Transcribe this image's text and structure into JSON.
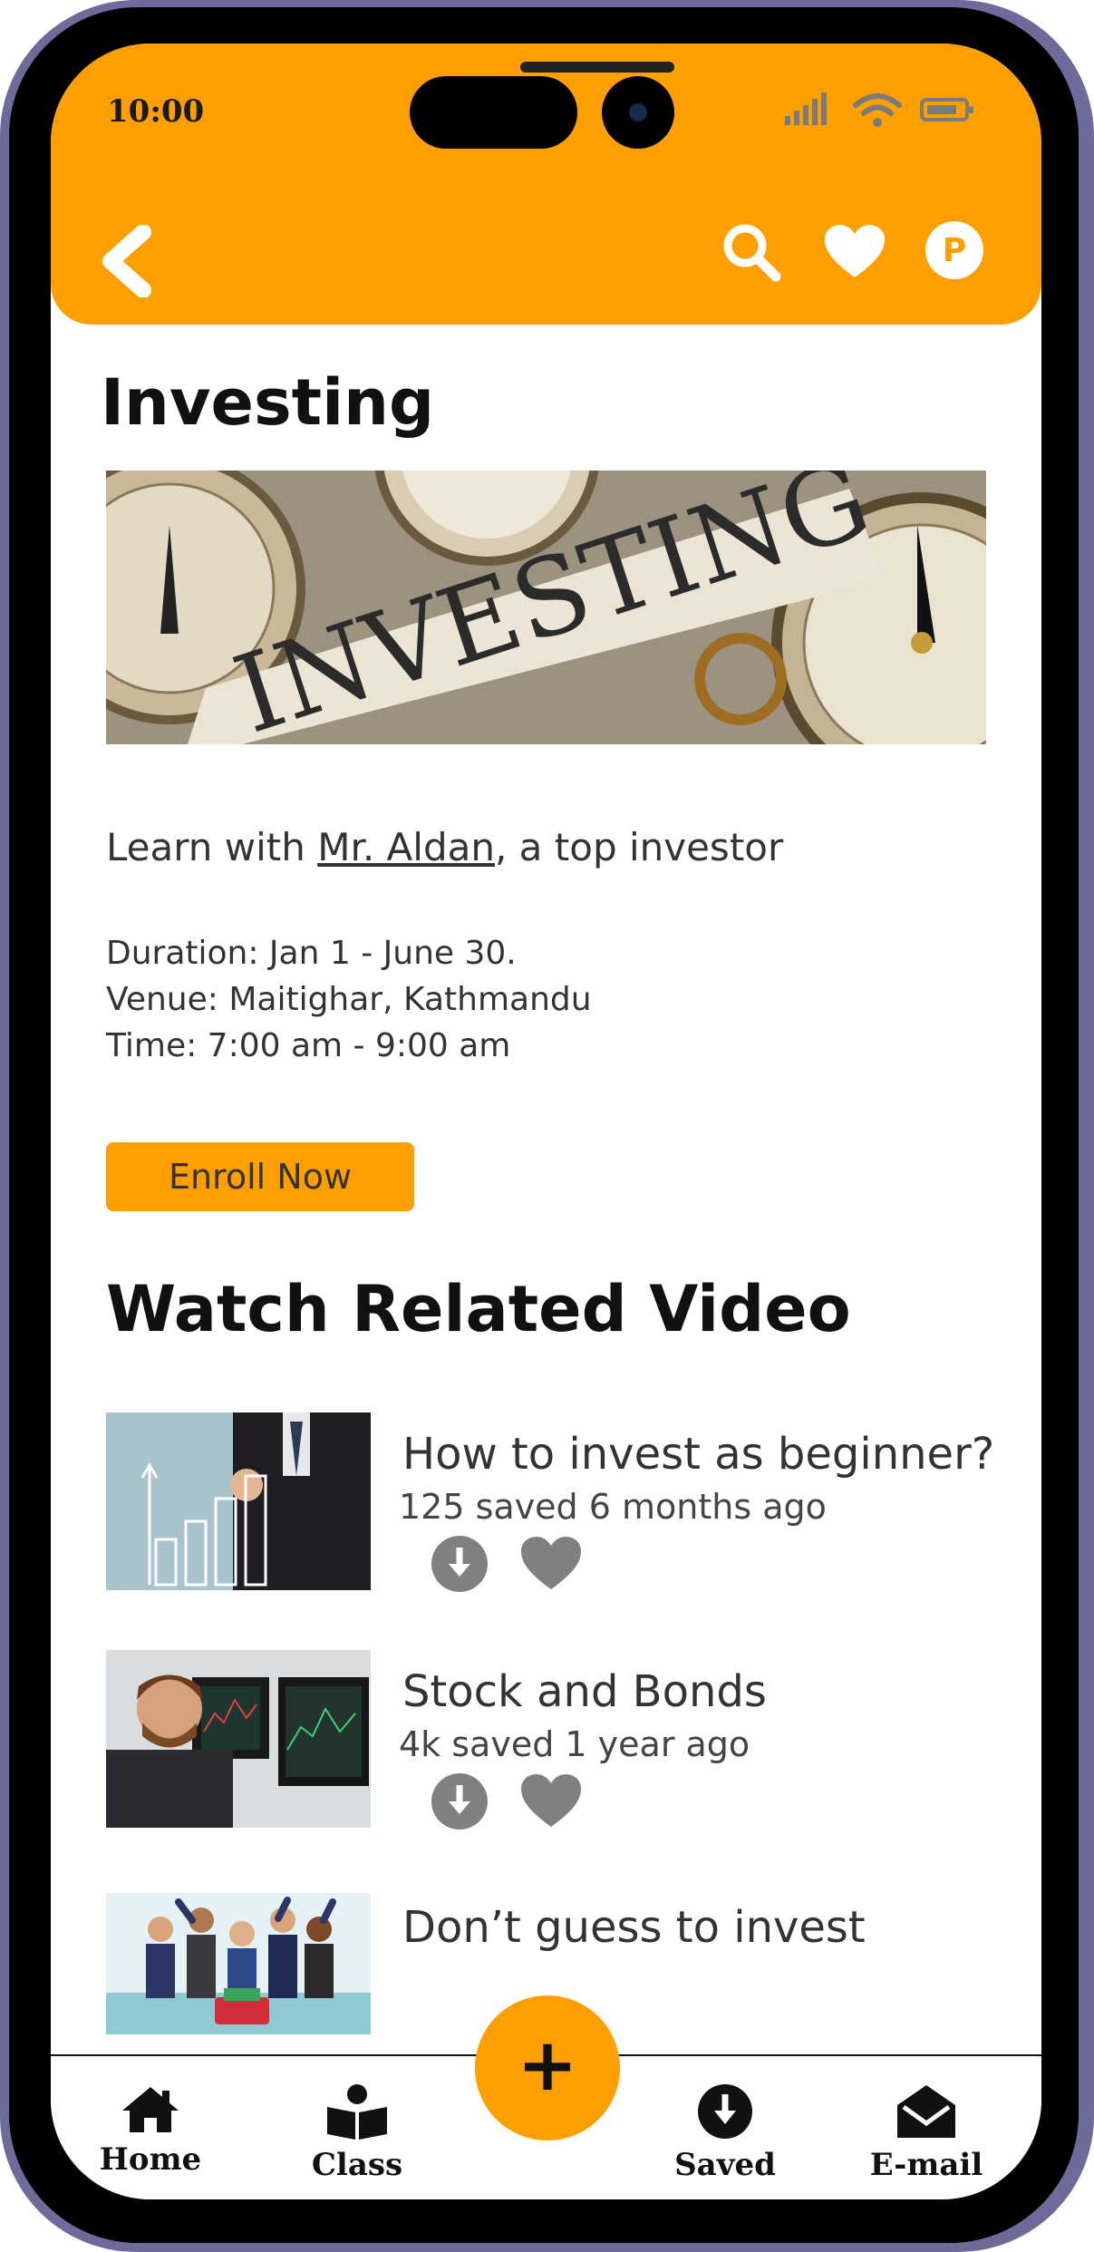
{
  "status_bar": {
    "time": "10:00"
  },
  "header": {
    "back": "back",
    "icons": [
      "search-icon",
      "heart-icon",
      "profile-p-icon"
    ],
    "profile_letter": "P"
  },
  "page": {
    "title": "Investing",
    "hero_text": "INVESTING",
    "intro_prefix": "Learn with ",
    "instructor": "Mr. Aldan",
    "intro_suffix": ", a top investor",
    "duration": "Duration: Jan 1 - June 30.",
    "venue": "Venue: Maitighar, Kathmandu",
    "time": "Time: 7:00 am - 9:00 am",
    "enroll_label": "Enroll Now"
  },
  "related": {
    "title": "Watch Related Video",
    "videos": [
      {
        "title": "How to invest as beginner?",
        "meta": "125 saved 6 months ago"
      },
      {
        "title": "Stock and Bonds",
        "meta": "4k saved 1 year ago"
      },
      {
        "title": "Don’t guess to invest",
        "meta": ""
      }
    ]
  },
  "nav": {
    "home": "Home",
    "class": "Class",
    "saved": "Saved",
    "email": "E-mail",
    "fab": "+"
  },
  "colors": {
    "accent": "#fd9f00",
    "frame": "#6e6a9a",
    "icon_gray": "#808080"
  }
}
